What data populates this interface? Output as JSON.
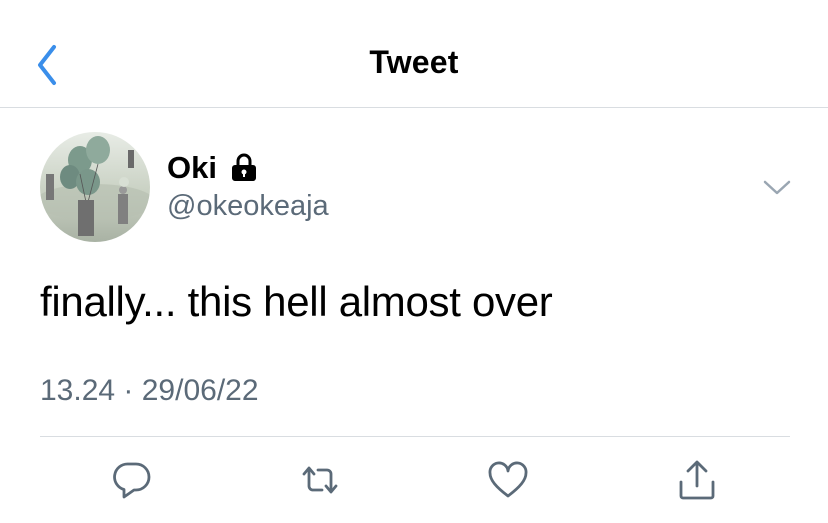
{
  "header": {
    "title": "Tweet",
    "back_icon": "chevron-left-icon"
  },
  "tweet": {
    "author": {
      "display_name": "Oki",
      "handle": "@okeokeaja",
      "protected_icon": "lock-icon"
    },
    "text": "finally... this hell almost over",
    "time": "13.24",
    "separator": " · ",
    "date": "29/06/22",
    "menu_icon": "chevron-down-icon"
  },
  "actions": [
    {
      "icon": "reply-icon"
    },
    {
      "icon": "retweet-icon"
    },
    {
      "icon": "like-icon"
    },
    {
      "icon": "share-icon"
    }
  ],
  "colors": {
    "accent": "#1d9bf0",
    "back_arrow": "#3a8eea",
    "secondary_text": "#5b6a78",
    "divider": "#d9dde1",
    "icon_gray": "#5b6a78"
  }
}
